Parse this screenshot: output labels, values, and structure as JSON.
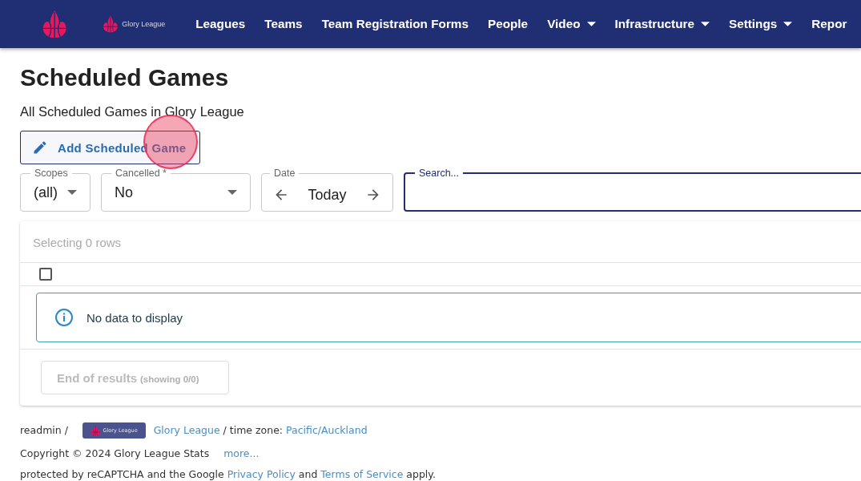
{
  "nav": {
    "logo_text": "Glory League",
    "items": [
      {
        "label": "Leagues",
        "dropdown": false
      },
      {
        "label": "Teams",
        "dropdown": false
      },
      {
        "label": "Team Registration Forms",
        "dropdown": false
      },
      {
        "label": "People",
        "dropdown": false
      },
      {
        "label": "Video",
        "dropdown": true
      },
      {
        "label": "Infrastructure",
        "dropdown": true
      },
      {
        "label": "Settings",
        "dropdown": true
      },
      {
        "label": "Repor",
        "dropdown": false
      }
    ]
  },
  "page": {
    "title": "Scheduled Games",
    "subtitle": "All Scheduled Games in Glory League"
  },
  "add_button": {
    "label": "Add Scheduled Game",
    "click_indicator": true
  },
  "filters": [
    {
      "kind": "select",
      "label": "Scopes",
      "value": "(all)"
    },
    {
      "kind": "select",
      "label": "Cancelled *",
      "value": "No"
    },
    {
      "kind": "date",
      "label": "Date",
      "value": "Today"
    },
    {
      "kind": "search",
      "label": "Search...",
      "focused": true
    }
  ],
  "table": {
    "selection_text": "Selecting 0 rows",
    "select_all_checked": false,
    "empty_message": "No data to display",
    "end_button": {
      "label": "End of results",
      "detail": "(showing 0/0)",
      "disabled": true
    }
  },
  "footer": {
    "user": "readmin /",
    "logo_text": "Glory League",
    "league_link": "Glory League",
    "timezone_label": "/ time zone:",
    "timezone_link": "Pacific/Auckland",
    "copyright": "Copyright © 2024 Glory League Stats",
    "more_link": "more...",
    "recaptcha": [
      {
        "text": "protected by reCAPTCHA and the Google ",
        "link": false
      },
      {
        "text": "Privacy Policy",
        "link": true
      },
      {
        "text": " and ",
        "link": false
      },
      {
        "text": "Terms of Service",
        "link": true
      },
      {
        "text": " apply.",
        "link": false
      }
    ]
  }
}
